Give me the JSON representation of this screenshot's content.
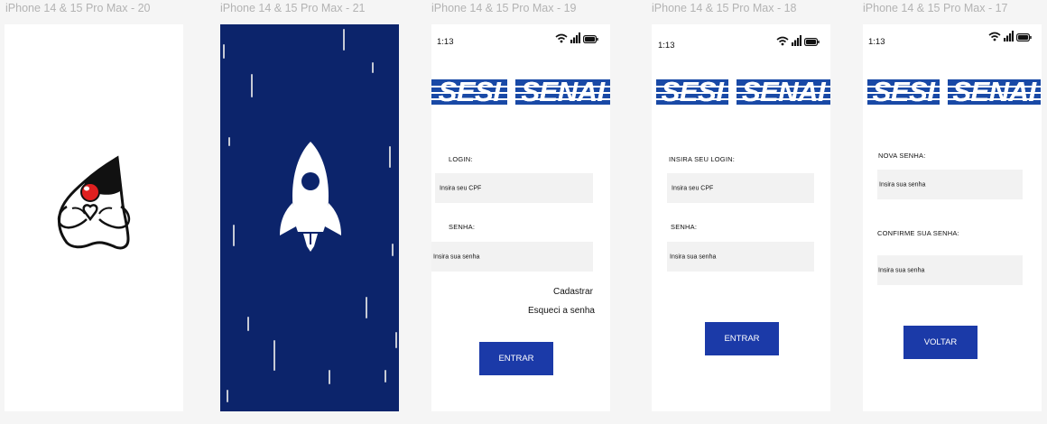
{
  "frames": {
    "f20": {
      "title": "iPhone 14 & 15 Pro Max - 20"
    },
    "f21": {
      "title": "iPhone 14 & 15 Pro Max - 21"
    },
    "f19": {
      "title": "iPhone 14 & 15 Pro Max - 19",
      "time": "1:13",
      "logos": [
        "SESI",
        "SENAI"
      ],
      "login_label": "LOGIN:",
      "login_placeholder": "Insira seu CPF",
      "senha_label": "SENHA:",
      "senha_placeholder": "Insira sua senha",
      "register_link": "Cadastrar",
      "forgot_link": "Esqueci a senha",
      "enter_button": "ENTRAR"
    },
    "f18": {
      "title": "iPhone 14 & 15 Pro Max - 18",
      "time": "1:13",
      "logos": [
        "SESI",
        "SENAI"
      ],
      "login_label": "INSIRA SEU  LOGIN:",
      "login_placeholder": "Insira seu CPF",
      "senha_label": "SENHA:",
      "senha_placeholder": "Insira sua senha",
      "enter_button": "ENTRAR"
    },
    "f17": {
      "title": "iPhone 14 & 15 Pro Max - 17",
      "time": "1:13",
      "logos": [
        "SESI",
        "SENAI"
      ],
      "new_password_label": "NOVA  SENHA:",
      "new_password_placeholder": "Insira sua  senha",
      "confirm_label": "CONFIRME SUA SENHA:",
      "confirm_placeholder": "Insira sua senha",
      "back_button": "VOLTAR"
    }
  },
  "colors": {
    "brand_blue": "#1949a6",
    "button_blue": "#1b3aa8",
    "splash_navy": "#0c246b",
    "field_gray": "#f2f2f2"
  },
  "icons": {
    "mascot": "java-duke-heart-icon",
    "rocket": "rocket-icon",
    "status": [
      "wifi-icon",
      "signal-icon",
      "battery-icon"
    ]
  }
}
